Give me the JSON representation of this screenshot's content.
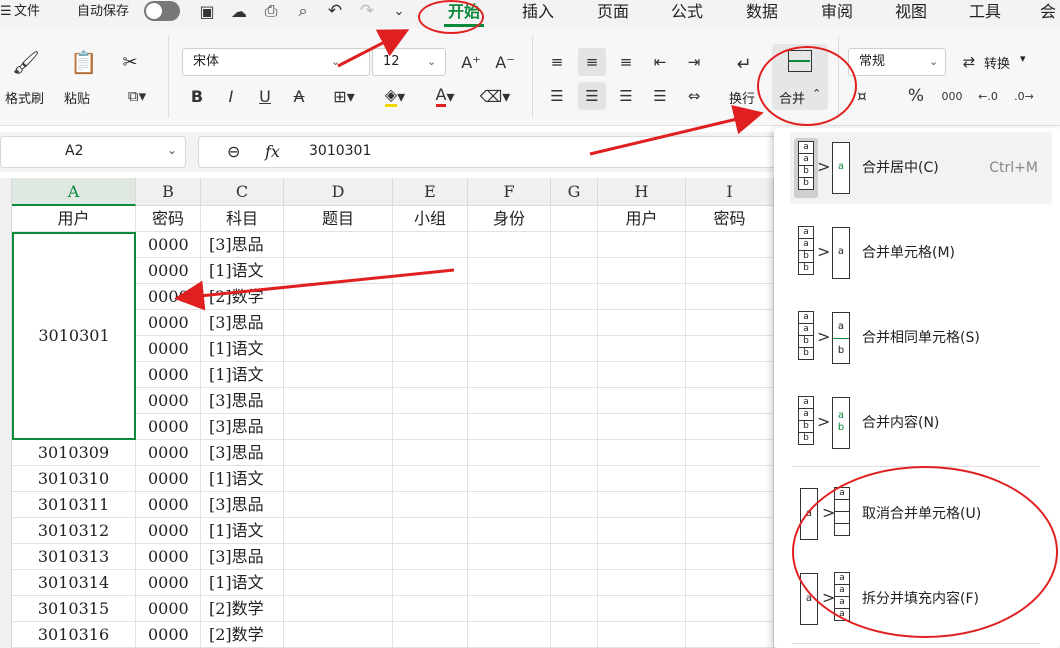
{
  "tabs": {
    "menu_icon": "☰",
    "file": "文件",
    "autosave": "自动保存",
    "items": [
      "开始",
      "插入",
      "页面",
      "公式",
      "数据",
      "审阅",
      "视图",
      "工具",
      "会"
    ]
  },
  "ribbon": {
    "format_painter": "格式刷",
    "paste": "粘贴",
    "font_name": "宋体",
    "font_size": "12",
    "wrap": "换行",
    "merge": "合并",
    "number_format": "常规",
    "convert": "转换"
  },
  "formula_bar": {
    "name_box": "A2",
    "fx": "fx",
    "value": "3010301"
  },
  "sheet": {
    "columns": [
      "A",
      "B",
      "C",
      "D",
      "E",
      "F",
      "G",
      "H",
      "I"
    ],
    "header_row": [
      "用户",
      "密码",
      "科目",
      "题目",
      "小组",
      "身份",
      "",
      "用户",
      "密码"
    ],
    "merged_value": "3010301",
    "rows": [
      {
        "user": "",
        "pwd": "0000",
        "subj": "[3]思品"
      },
      {
        "user": "",
        "pwd": "0000",
        "subj": "[1]语文"
      },
      {
        "user": "",
        "pwd": "0000",
        "subj": "[2]数学"
      },
      {
        "user": "",
        "pwd": "0000",
        "subj": "[3]思品"
      },
      {
        "user": "",
        "pwd": "0000",
        "subj": "[1]语文"
      },
      {
        "user": "",
        "pwd": "0000",
        "subj": "[1]语文"
      },
      {
        "user": "",
        "pwd": "0000",
        "subj": "[3]思品"
      },
      {
        "user": "",
        "pwd": "0000",
        "subj": "[3]思品"
      },
      {
        "user": "3010309",
        "pwd": "0000",
        "subj": "[3]思品"
      },
      {
        "user": "3010310",
        "pwd": "0000",
        "subj": "[1]语文"
      },
      {
        "user": "3010311",
        "pwd": "0000",
        "subj": "[3]思品"
      },
      {
        "user": "3010312",
        "pwd": "0000",
        "subj": "[1]语文"
      },
      {
        "user": "3010313",
        "pwd": "0000",
        "subj": "[3]思品"
      },
      {
        "user": "3010314",
        "pwd": "0000",
        "subj": "[1]语文"
      },
      {
        "user": "3010315",
        "pwd": "0000",
        "subj": "[2]数学"
      },
      {
        "user": "3010316",
        "pwd": "0000",
        "subj": "[2]数学"
      }
    ]
  },
  "merge_menu": [
    {
      "label": "合并居中(C)",
      "shortcut": "Ctrl+M"
    },
    {
      "label": "合并单元格(M)",
      "shortcut": ""
    },
    {
      "label": "合并相同单元格(S)",
      "shortcut": ""
    },
    {
      "label": "合并内容(N)",
      "shortcut": ""
    },
    {
      "label": "取消合并单元格(U)",
      "shortcut": ""
    },
    {
      "label": "拆分并填充内容(F)",
      "shortcut": ""
    }
  ],
  "menu_icon_letters": {
    "a": "a",
    "b": "b"
  },
  "colors": {
    "accent": "#0b8a3c",
    "annotation": "#e02020"
  }
}
